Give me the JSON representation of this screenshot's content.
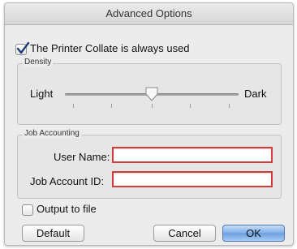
{
  "window": {
    "title": "Advanced Options"
  },
  "collate": {
    "label": "The Printer Collate is always used",
    "checked": true
  },
  "density": {
    "legend": "Density",
    "min_label": "Light",
    "max_label": "Dark",
    "level_fraction": 0.5
  },
  "job_accounting": {
    "legend": "Job Accounting",
    "user_name_label": "User Name:",
    "user_name_value": "",
    "job_account_id_label": "Job Account ID:",
    "job_account_id_value": ""
  },
  "output_to_file": {
    "label": "Output to file",
    "checked": false
  },
  "buttons": {
    "default": "Default",
    "cancel": "Cancel",
    "ok": "OK"
  },
  "colors": {
    "invalid_field_border": "#d33a3a",
    "default_button": "#6b9fe0"
  }
}
